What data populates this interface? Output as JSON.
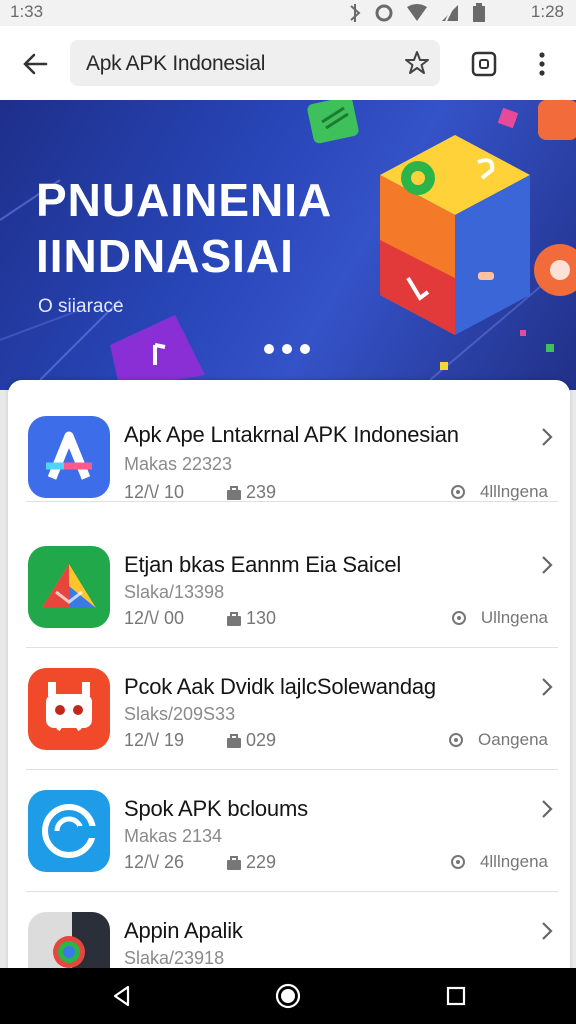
{
  "status": {
    "time_left": "1:33",
    "time_right": "1:28"
  },
  "browser": {
    "url": "Apk APK Indonesial"
  },
  "banner": {
    "title_line1": "PNUAINENIA",
    "title_line2": "IINDNASIAI",
    "subtitle": "O siiarace"
  },
  "apps": [
    {
      "name": "Apk Ape Lntakrnal APK Indonesian",
      "size": "Makas 22323",
      "date": "12/\\/ 10",
      "downloads": "239",
      "lang": "4lllngena"
    },
    {
      "name": "Etjan bkas Eannm Eia Saicel",
      "size": "Slaka/13398",
      "date": "12/\\/ 00",
      "downloads": "130",
      "lang": "Ullngena"
    },
    {
      "name": "Pcok Aak Dvidk lajlcSolewandag",
      "size": "Slaks/209S33",
      "date": "12/\\/ 19",
      "downloads": "029",
      "lang": "Oangena"
    },
    {
      "name": "Spok APK bcloums",
      "size": "Makas 2134",
      "date": "12/\\/ 26",
      "downloads": "229",
      "lang": "4lllngena"
    },
    {
      "name": "Appin Apalik",
      "size": "Slaka/23918",
      "date": "",
      "downloads": "",
      "lang": ""
    }
  ],
  "colors": {
    "banner_blue": "#2846b8",
    "accent_orange": "#f5a623",
    "status_gray": "#6a6a6a"
  },
  "icons": [
    "back-arrow-icon",
    "star-icon",
    "tab-icon",
    "more-vert-icon",
    "chevron-right-icon",
    "download-icon",
    "globe-icon",
    "nav-back-icon",
    "nav-home-icon",
    "nav-recents-icon"
  ]
}
